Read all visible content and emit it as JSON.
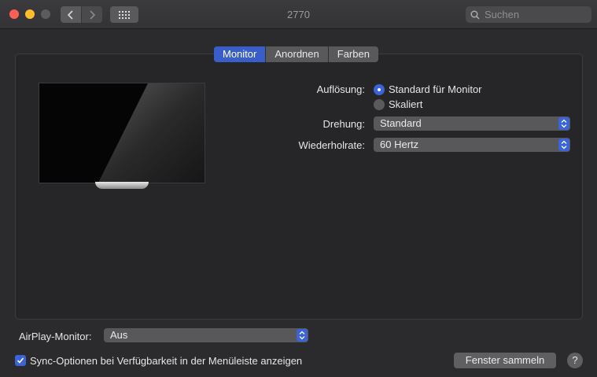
{
  "window": {
    "title": "2770",
    "search_placeholder": "Suchen",
    "icons": {
      "back": "chevron-left-icon",
      "forward": "chevron-right-icon",
      "grid": "grid-icon",
      "search": "search-icon"
    }
  },
  "tabs": [
    {
      "label": "Monitor",
      "active": true
    },
    {
      "label": "Anordnen",
      "active": false
    },
    {
      "label": "Farben",
      "active": false
    }
  ],
  "settings": {
    "resolution": {
      "label": "Auflösung:",
      "options": [
        {
          "label": "Standard für Monitor",
          "selected": true
        },
        {
          "label": "Skaliert",
          "selected": false
        }
      ]
    },
    "rotation": {
      "label": "Drehung:",
      "value": "Standard"
    },
    "refresh_rate": {
      "label": "Wiederholrate:",
      "value": "60 Hertz"
    }
  },
  "airplay": {
    "label": "AirPlay-Monitor:",
    "value": "Aus"
  },
  "sync_option": {
    "label": "Sync-Optionen bei Verfügbarkeit in der Menüleiste anzeigen",
    "checked": true
  },
  "gather_button": {
    "label": "Fenster sammeln"
  },
  "help_button": {
    "label": "?"
  },
  "colors": {
    "accent": "#3a64d8",
    "window_bg": "#2b2b2d",
    "panel_bg": "#262628"
  }
}
